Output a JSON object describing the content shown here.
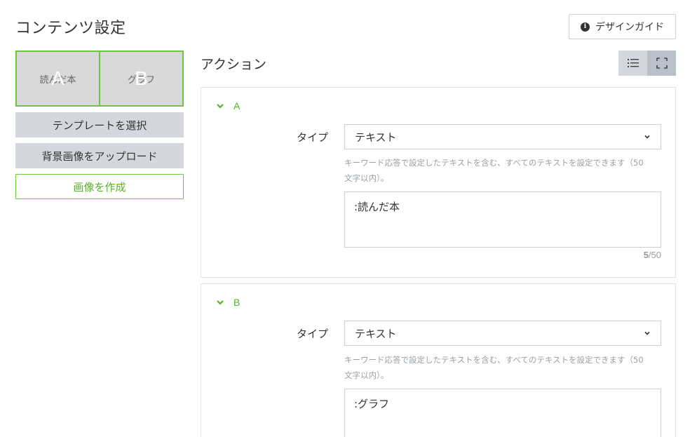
{
  "header": {
    "title": "コンテンツ設定",
    "guide_button": "デザインガイド",
    "guide_icon": "info-icon"
  },
  "preview": {
    "cells": [
      {
        "letter": "A",
        "text": "読んだ本"
      },
      {
        "letter": "B",
        "text": "グラフ"
      }
    ]
  },
  "sidebar": {
    "template_button": "テンプレートを選択",
    "upload_button": "背景画像をアップロード",
    "create_button": "画像を作成"
  },
  "actions": {
    "title": "アクション",
    "view_list_icon": "list-icon",
    "view_expand_icon": "expand-icon",
    "panels": [
      {
        "name": "A",
        "type_label": "タイプ",
        "type_value": "テキスト",
        "help_line1": "キーワード応答で設定したテキストを含む、すべてのテキストを設定できます（50",
        "help_line2": "文字以内）。",
        "text_value": ":読んだ本",
        "count_current": "5",
        "count_max": "/50"
      },
      {
        "name": "B",
        "type_label": "タイプ",
        "type_value": "テキスト",
        "help_line1": "キーワード応答で設定したテキストを含む、すべてのテキストを設定できます（50",
        "help_line2": "文字以内）。",
        "text_value": ":グラフ"
      }
    ]
  },
  "colors": {
    "accent_green": "#6cc644",
    "button_gray": "#d4d8de",
    "toggle_active": "#b9c0c9"
  }
}
